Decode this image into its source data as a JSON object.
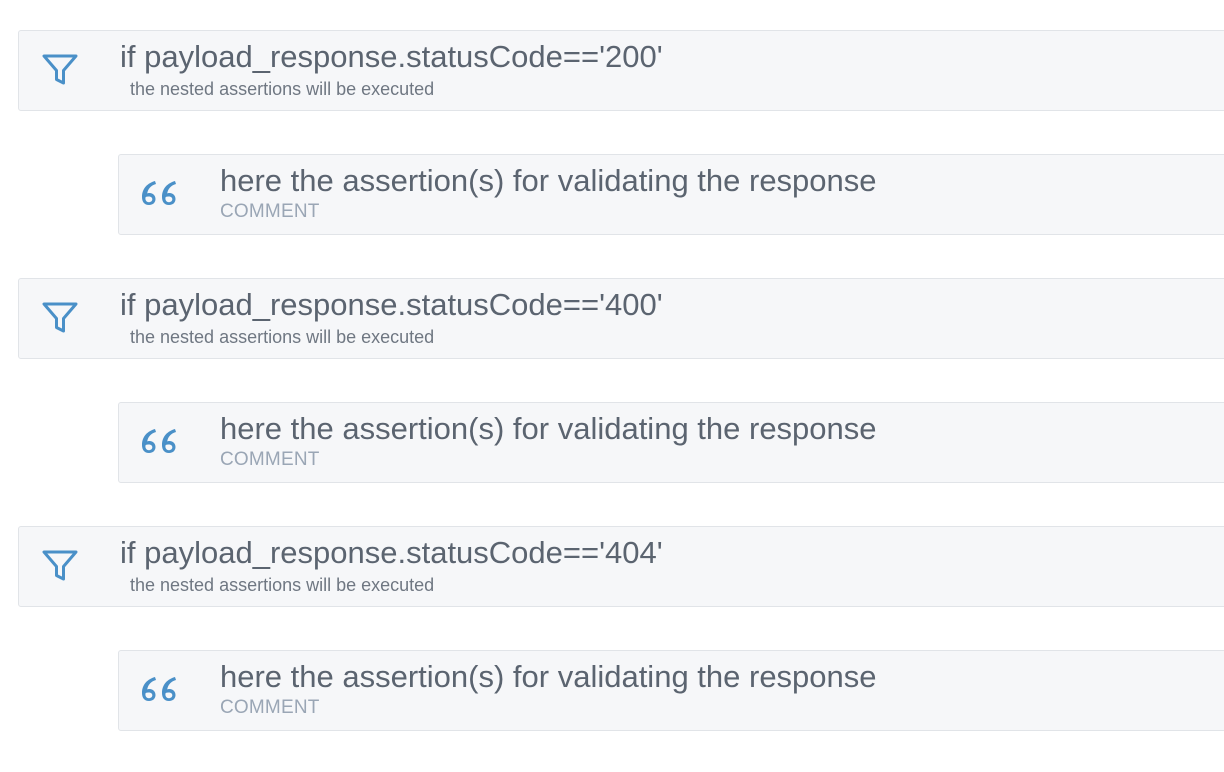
{
  "blocks": [
    {
      "kind": "condition",
      "icon": "filter-icon",
      "title": "if payload_response.statusCode=='200'",
      "subtitle": "the nested assertions will be executed"
    },
    {
      "kind": "comment",
      "icon": "quote-icon",
      "title": "here the assertion(s) for validating the response",
      "subtitle": "COMMENT"
    },
    {
      "kind": "condition",
      "icon": "filter-icon",
      "title": "if payload_response.statusCode=='400'",
      "subtitle": "the nested assertions will be executed"
    },
    {
      "kind": "comment",
      "icon": "quote-icon",
      "title": "here the assertion(s) for validating the response",
      "subtitle": "COMMENT"
    },
    {
      "kind": "condition",
      "icon": "filter-icon",
      "title": "if payload_response.statusCode=='404'",
      "subtitle": "the nested assertions will be executed"
    },
    {
      "kind": "comment",
      "icon": "quote-icon",
      "title": "here the assertion(s) for validating the response",
      "subtitle": "COMMENT"
    }
  ],
  "colors": {
    "icon": "#4a90c8",
    "title": "#5b6470",
    "condition_subtitle": "#6f7782",
    "comment_subtitle": "#9aa6b5",
    "card_background": "#f6f7f9",
    "card_border": "#e1e4e8"
  }
}
